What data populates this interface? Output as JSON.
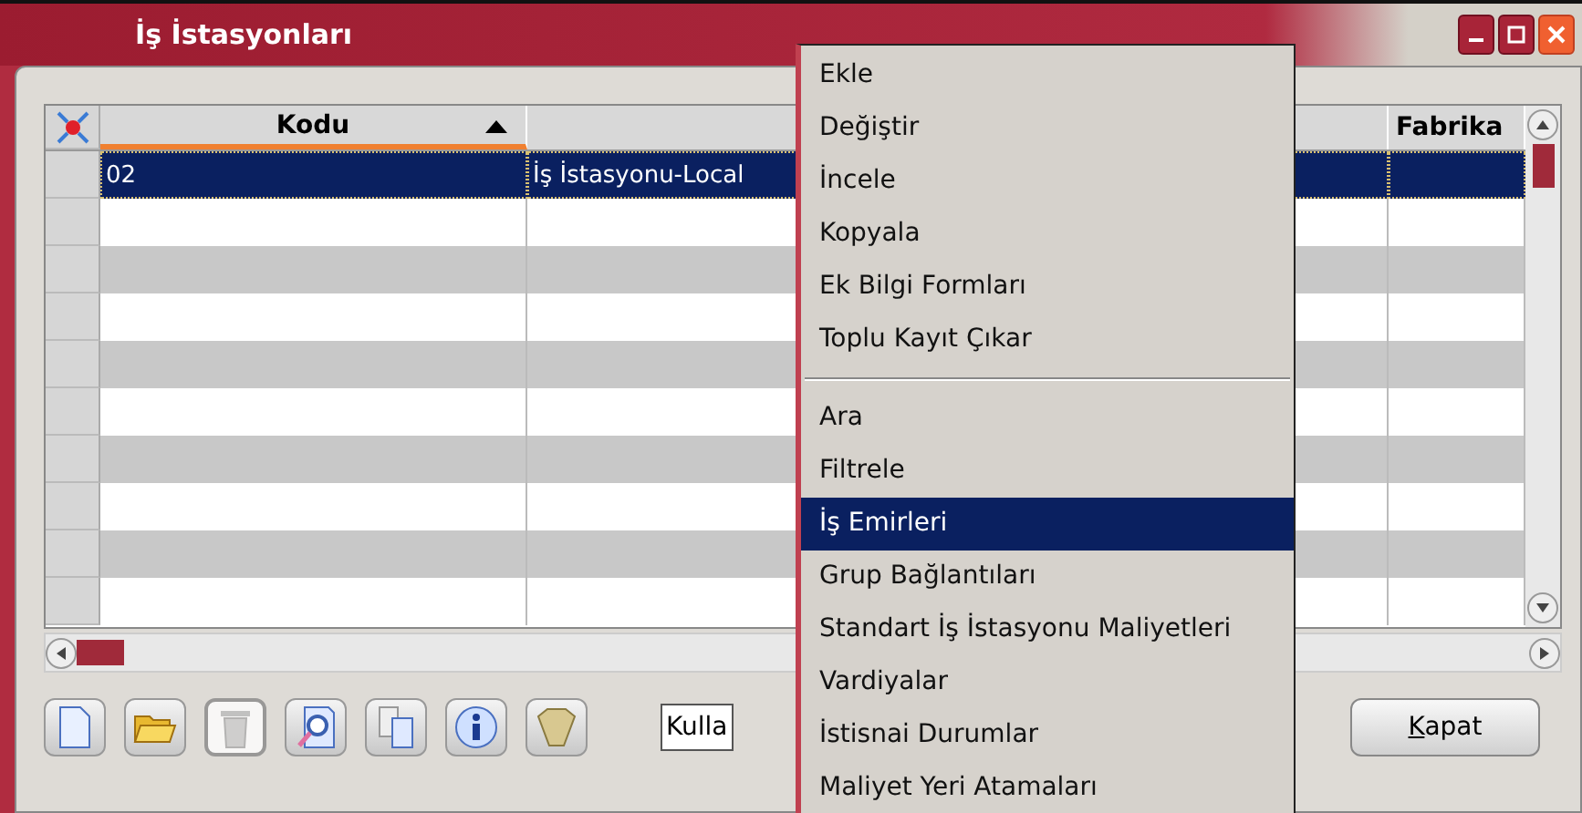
{
  "window": {
    "title": "İş İstasyonları"
  },
  "table": {
    "columns": [
      {
        "label": "Kodu",
        "sorted": true
      },
      {
        "sorted": false
      },
      {
        "label": "Fabrika",
        "sorted": false
      }
    ],
    "rows": [
      {
        "cells": [
          "02",
          "İş İstasyonu-Local"
        ],
        "selected": true
      },
      {
        "cells": [],
        "selected": false
      },
      {
        "cells": [],
        "selected": false
      },
      {
        "cells": [],
        "selected": false
      },
      {
        "cells": [],
        "selected": false
      },
      {
        "cells": [],
        "selected": false
      },
      {
        "cells": [],
        "selected": false
      },
      {
        "cells": [],
        "selected": false
      },
      {
        "cells": [],
        "selected": false
      },
      {
        "cells": [],
        "selected": false
      }
    ]
  },
  "toolbar": [
    {
      "kind": "new"
    },
    {
      "kind": "open"
    },
    {
      "kind": "delete",
      "disabled": true
    },
    {
      "kind": "preview"
    },
    {
      "kind": "copy"
    },
    {
      "kind": "info"
    },
    {
      "kind": "filter"
    }
  ],
  "user_field": {
    "value": "Kulla"
  },
  "close_button": "Kapat",
  "context_menu": [
    {
      "label": "Ekle",
      "selected": false
    },
    {
      "label": "Değiştir",
      "selected": false
    },
    {
      "label": "İncele",
      "selected": false
    },
    {
      "label": "Kopyala",
      "selected": false
    },
    {
      "label": "Ek Bilgi Formları",
      "selected": false
    },
    {
      "label": "Toplu Kayıt Çıkar",
      "selected": false
    },
    {
      "kind": "separator"
    },
    {
      "label": "Ara",
      "selected": false
    },
    {
      "label": "Filtrele",
      "selected": false
    },
    {
      "label": "İş Emirleri",
      "selected": true
    },
    {
      "label": "Grup Bağlantıları",
      "selected": false
    },
    {
      "label": "Standart İş İstasyonu Maliyetleri",
      "selected": false
    },
    {
      "label": "Vardiyalar",
      "selected": false
    },
    {
      "label": "İstisnai Durumlar",
      "selected": false
    },
    {
      "label": "Maliyet Yeri Atamaları",
      "selected": false
    }
  ]
}
